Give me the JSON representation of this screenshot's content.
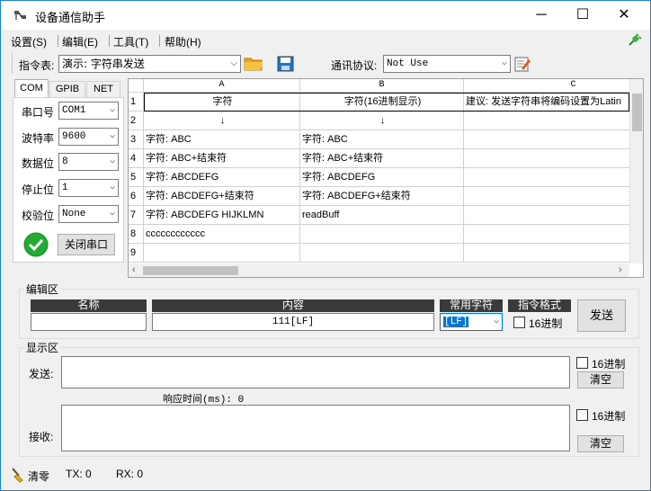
{
  "window": {
    "title": "设备通信助手"
  },
  "menu": [
    "设置(S)",
    "编辑(E)",
    "工具(T)",
    "帮助(H)"
  ],
  "toolbar": {
    "cmd_label": "指令表:",
    "cmd_value": "演示: 字符串发送",
    "protocol_label": "通讯协议:",
    "protocol_value": "Not Use"
  },
  "tabs": [
    "COM",
    "GPIB",
    "NET"
  ],
  "serial": {
    "fields": [
      {
        "label": "串口号",
        "value": "COM1"
      },
      {
        "label": "波特率",
        "value": "9600"
      },
      {
        "label": "数据位",
        "value": "8"
      },
      {
        "label": "停止位",
        "value": "1"
      },
      {
        "label": "校验位",
        "value": "None"
      }
    ],
    "close_btn": "关闭串口",
    "status_color": "#22aa33"
  },
  "grid": {
    "columns": [
      "A",
      "B",
      "C"
    ],
    "rows": [
      {
        "n": "1",
        "a": "字符",
        "b": "字符(16进制显示)",
        "c": "建议: 发送字符串将编码设置为Latin"
      },
      {
        "n": "2",
        "a": "↓",
        "b": "↓",
        "c": ""
      },
      {
        "n": "3",
        "a": "字符: ABC",
        "b": "字符: ABC",
        "c": ""
      },
      {
        "n": "4",
        "a": "字符: ABC+结束符",
        "b": "字符: ABC+结束符",
        "c": ""
      },
      {
        "n": "5",
        "a": "字符: ABCDEFG",
        "b": "字符: ABCDEFG",
        "c": ""
      },
      {
        "n": "6",
        "a": "字符: ABCDEFG+结束符",
        "b": "字符: ABCDEFG+结束符",
        "c": ""
      },
      {
        "n": "7",
        "a": "字符: ABCDEFG HIJKLMN",
        "b": "readBuff",
        "c": ""
      },
      {
        "n": "8",
        "a": "cccccccccccc",
        "b": "",
        "c": ""
      },
      {
        "n": "9",
        "a": "",
        "b": "",
        "c": ""
      }
    ]
  },
  "edit": {
    "title": "编辑区",
    "name_header": "名称",
    "content_header": "内容",
    "common_header": "常用字符",
    "format_header": "指令格式",
    "name_value": "",
    "content_value": "111[LF]",
    "common_value": "[LF]",
    "hex_label": "16进制",
    "send_btn": "发送"
  },
  "display": {
    "title": "显示区",
    "send_label": "发送:",
    "recv_label": "接收:",
    "response": "响应时间(ms): 0",
    "hex_label": "16进制",
    "clear_btn": "清空"
  },
  "status": {
    "clear": "清零",
    "tx": "TX:  0",
    "rx": "RX:  0"
  }
}
